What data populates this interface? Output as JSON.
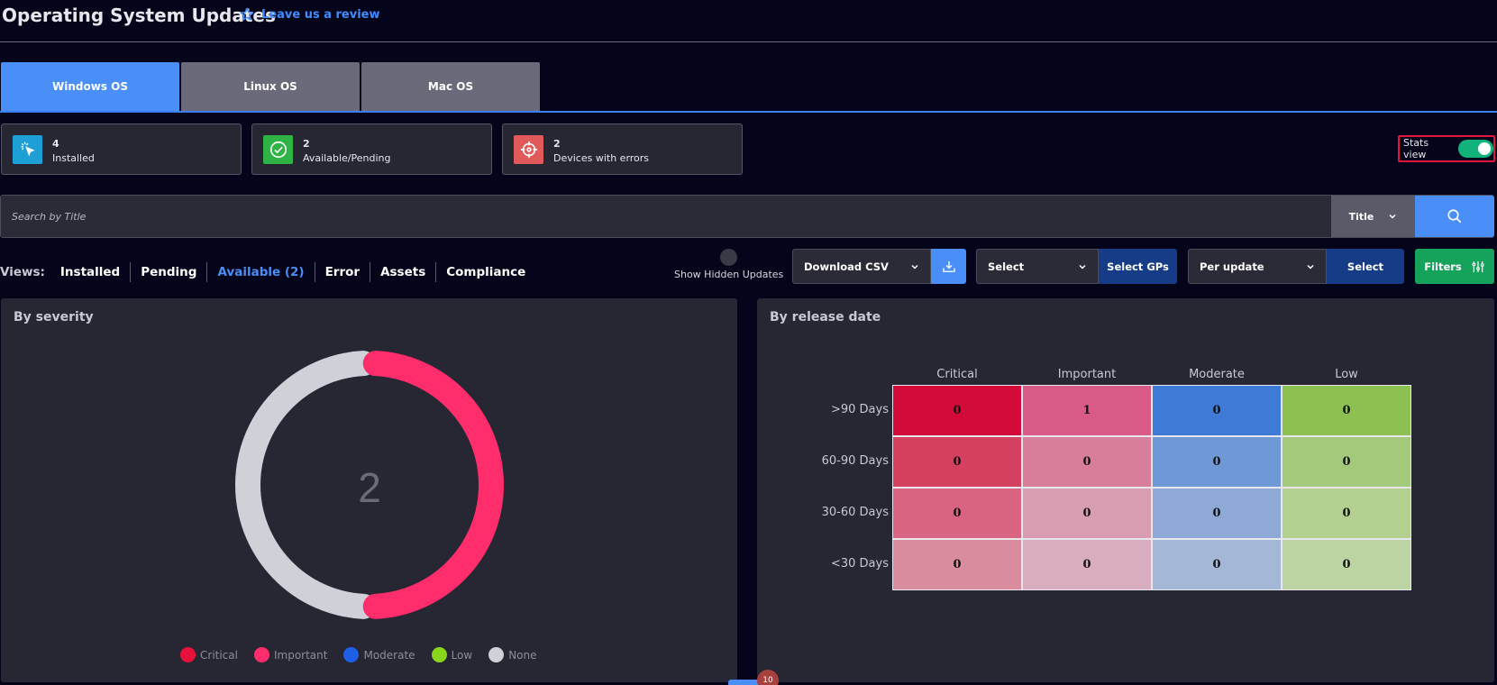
{
  "header": {
    "title": "Operating System Updates",
    "review_label": "Leave us a review"
  },
  "tabs": [
    {
      "label": "Windows OS",
      "active": true
    },
    {
      "label": "Linux OS",
      "active": false
    },
    {
      "label": "Mac OS",
      "active": false
    }
  ],
  "stats": [
    {
      "value": "4",
      "label": "Installed",
      "icon": "cursor-click-icon",
      "color": "#1e9fd6"
    },
    {
      "value": "2",
      "label": "Available/Pending",
      "icon": "check-circle-icon",
      "color": "#2fb344"
    },
    {
      "value": "2",
      "label": "Devices with errors",
      "icon": "crosshair-icon",
      "color": "#e05a5a"
    }
  ],
  "stats_view": {
    "label": "Stats view",
    "enabled": true
  },
  "search": {
    "placeholder": "Search by Title",
    "field": "Title"
  },
  "views": {
    "label": "Views:",
    "items": [
      "Installed",
      "Pending",
      "Available (2)",
      "Error",
      "Assets",
      "Compliance"
    ],
    "active": "Available (2)"
  },
  "show_hidden": {
    "label": "Show Hidden Updates"
  },
  "controls": {
    "download": "Download CSV",
    "gp_select": "Select",
    "gp_button": "Select GPs",
    "per_update": "Per update",
    "per_update_button": "Select",
    "filters": "Filters"
  },
  "severity_panel": {
    "title": "By severity",
    "total": "2",
    "legend": [
      {
        "name": "Critical",
        "color": "#e8113c"
      },
      {
        "name": "Important",
        "color": "#ff2d6b"
      },
      {
        "name": "Moderate",
        "color": "#1f5fe8"
      },
      {
        "name": "Low",
        "color": "#8ad61c"
      },
      {
        "name": "None",
        "color": "#d0d0d8"
      }
    ]
  },
  "release_panel": {
    "title": "By release date"
  },
  "chart_data": [
    {
      "type": "pie",
      "title": "By severity",
      "categories": [
        "Critical",
        "Important",
        "Moderate",
        "Low",
        "None"
      ],
      "values": [
        0,
        1,
        0,
        0,
        1
      ],
      "center_label": "2",
      "legend": "bottom"
    },
    {
      "type": "heatmap",
      "title": "By release date",
      "columns": [
        "Critical",
        "Important",
        "Moderate",
        "Low"
      ],
      "rows": [
        ">90 Days",
        "60-90 Days",
        "30-60 Days",
        "<30 Days"
      ],
      "values": [
        [
          0,
          1,
          0,
          0
        ],
        [
          0,
          0,
          0,
          0
        ],
        [
          0,
          0,
          0,
          0
        ],
        [
          0,
          0,
          0,
          0
        ]
      ],
      "colors": [
        [
          "#d40b3a",
          "#d85a86",
          "#3f7ad6",
          "#8cc152"
        ],
        [
          "#d4405f",
          "#d77e9b",
          "#6f98d6",
          "#a3c97b"
        ],
        [
          "#d86482",
          "#d99db2",
          "#8ea9d6",
          "#b3d091"
        ],
        [
          "#d88c9e",
          "#d8adbf",
          "#a4b7d6",
          "#bcd3a4"
        ]
      ]
    }
  ],
  "footer": {
    "badge": "10"
  }
}
